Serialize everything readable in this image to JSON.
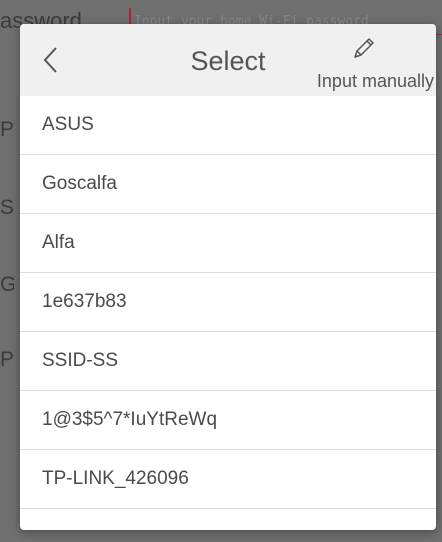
{
  "background": {
    "password_label": "assword",
    "password_placeholder": "Input your home Wi-Fi password",
    "side_letters": [
      "P",
      "S",
      "G",
      "P"
    ]
  },
  "dialog": {
    "title": "Select",
    "back_icon": "chevron-left-icon",
    "manual_icon": "pencil-icon",
    "manual_label": "Input manually",
    "networks": [
      "ASUS",
      "Goscalfa",
      "Alfa",
      "1e637b83",
      "SSID-SS",
      "1@3$5^7*IuYtReWq",
      "TP-LINK_426096",
      ""
    ]
  },
  "colors": {
    "overlay": "#6f6f6f",
    "accent": "#b0203a",
    "header_bg": "#f0f0f0"
  }
}
